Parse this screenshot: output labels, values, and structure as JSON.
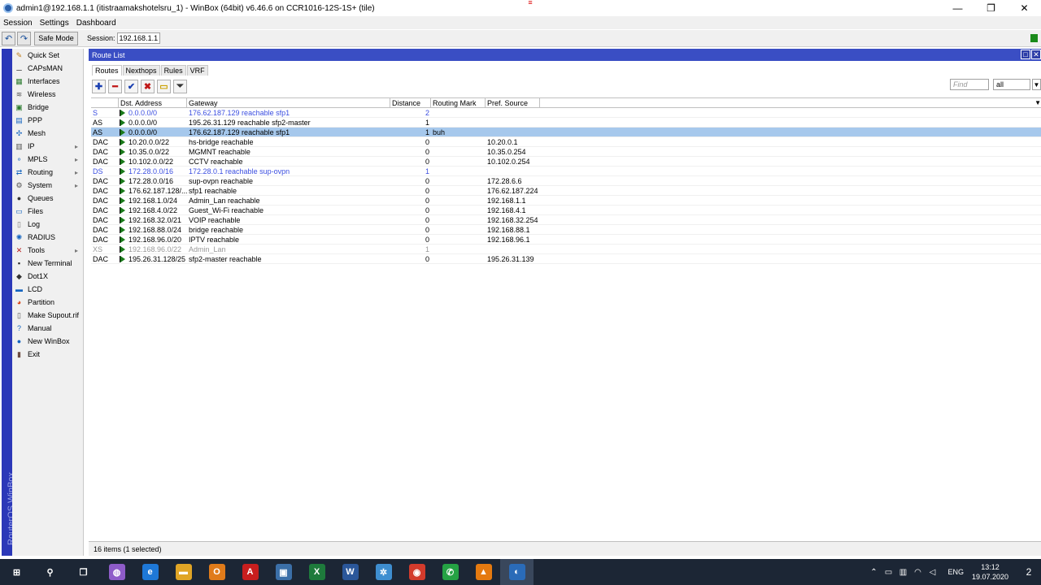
{
  "window": {
    "title": "admin1@192.168.1.1 (itistraamakshotelsru_1) - WinBox (64bit) v6.46.6 on CCR1016-12S-1S+ (tile)",
    "controls": [
      "—",
      "❐",
      "✕"
    ]
  },
  "menubar": [
    "Session",
    "Settings",
    "Dashboard"
  ],
  "toolbar": {
    "undo": "↶",
    "redo": "↷",
    "safe_mode": "Safe Mode",
    "session_label": "Session:",
    "session_value": "192.168.1.1"
  },
  "brand": "RouterOS WinBox",
  "sidebar": [
    {
      "label": "Quick Set",
      "icon": "quick-set-icon",
      "glyph": "✎",
      "color": "#c08020",
      "arrow": false
    },
    {
      "label": "CAPsMAN",
      "icon": "capsman-icon",
      "glyph": "⚊",
      "color": "#555555",
      "arrow": false
    },
    {
      "label": "Interfaces",
      "icon": "interfaces-icon",
      "glyph": "▦",
      "color": "#2e7d32",
      "arrow": false
    },
    {
      "label": "Wireless",
      "icon": "wireless-icon",
      "glyph": "≋",
      "color": "#555555",
      "arrow": false
    },
    {
      "label": "Bridge",
      "icon": "bridge-icon",
      "glyph": "▣",
      "color": "#2e7d32",
      "arrow": false
    },
    {
      "label": "PPP",
      "icon": "ppp-icon",
      "glyph": "▤",
      "color": "#1565c0",
      "arrow": false
    },
    {
      "label": "Mesh",
      "icon": "mesh-icon",
      "glyph": "✣",
      "color": "#1565c0",
      "arrow": false
    },
    {
      "label": "IP",
      "icon": "ip-icon",
      "glyph": "▥",
      "color": "#555555",
      "arrow": true
    },
    {
      "label": "MPLS",
      "icon": "mpls-icon",
      "glyph": "⚬",
      "color": "#1565c0",
      "arrow": true
    },
    {
      "label": "Routing",
      "icon": "routing-icon",
      "glyph": "⇄",
      "color": "#1565c0",
      "arrow": true
    },
    {
      "label": "System",
      "icon": "system-icon",
      "glyph": "⚙",
      "color": "#555555",
      "arrow": true
    },
    {
      "label": "Queues",
      "icon": "queues-icon",
      "glyph": "●",
      "color": "#333333",
      "arrow": false
    },
    {
      "label": "Files",
      "icon": "files-icon",
      "glyph": "▭",
      "color": "#1565c0",
      "arrow": false
    },
    {
      "label": "Log",
      "icon": "log-icon",
      "glyph": "▯",
      "color": "#777777",
      "arrow": false
    },
    {
      "label": "RADIUS",
      "icon": "radius-icon",
      "glyph": "✺",
      "color": "#1565c0",
      "arrow": false
    },
    {
      "label": "Tools",
      "icon": "tools-icon",
      "glyph": "✕",
      "color": "#b71c1c",
      "arrow": true
    },
    {
      "label": "New Terminal",
      "icon": "terminal-icon",
      "glyph": "▪",
      "color": "#222222",
      "arrow": false
    },
    {
      "label": "Dot1X",
      "icon": "dot1x-icon",
      "glyph": "◆",
      "color": "#333333",
      "arrow": false
    },
    {
      "label": "LCD",
      "icon": "lcd-icon",
      "glyph": "▬",
      "color": "#1565c0",
      "arrow": false
    },
    {
      "label": "Partition",
      "icon": "partition-icon",
      "glyph": "◕",
      "color": "#d84315",
      "arrow": false
    },
    {
      "label": "Make Supout.rif",
      "icon": "supout-icon",
      "glyph": "▯",
      "color": "#555555",
      "arrow": false
    },
    {
      "label": "Manual",
      "icon": "manual-icon",
      "glyph": "?",
      "color": "#1565c0",
      "arrow": false
    },
    {
      "label": "New WinBox",
      "icon": "winbox-icon",
      "glyph": "●",
      "color": "#1565c0",
      "arrow": false
    },
    {
      "label": "Exit",
      "icon": "exit-icon",
      "glyph": "▮",
      "color": "#6d4c41",
      "arrow": false
    }
  ],
  "route_list": {
    "title": "Route List",
    "tabs": [
      "Routes",
      "Nexthops",
      "Rules",
      "VRF"
    ],
    "active_tab": "Routes",
    "find_placeholder": "Find",
    "find_filter": "all",
    "columns": [
      "",
      "Dst. Address",
      "Gateway",
      "Distance",
      "Routing Mark",
      "Pref. Source"
    ],
    "rows": [
      {
        "flags": "S",
        "dst": "0.0.0.0/0",
        "gateway": "176.62.187.129 reachable sfp1",
        "distance": "2",
        "mark": "",
        "pref": "",
        "style": "blue"
      },
      {
        "flags": "AS",
        "dst": "0.0.0.0/0",
        "gateway": "195.26.31.129 reachable sfp2-master",
        "distance": "1",
        "mark": "",
        "pref": "",
        "style": ""
      },
      {
        "flags": "AS",
        "dst": "0.0.0.0/0",
        "gateway": "176.62.187.129 reachable sfp1",
        "distance": "1",
        "mark": "buh",
        "pref": "",
        "style": "selected"
      },
      {
        "flags": "DAC",
        "dst": "10.20.0.0/22",
        "gateway": "hs-bridge reachable",
        "distance": "0",
        "mark": "",
        "pref": "10.20.0.1",
        "style": ""
      },
      {
        "flags": "DAC",
        "dst": "10.35.0.0/22",
        "gateway": "MGMNT reachable",
        "distance": "0",
        "mark": "",
        "pref": "10.35.0.254",
        "style": ""
      },
      {
        "flags": "DAC",
        "dst": "10.102.0.0/22",
        "gateway": "CCTV reachable",
        "distance": "0",
        "mark": "",
        "pref": "10.102.0.254",
        "style": ""
      },
      {
        "flags": "DS",
        "dst": "172.28.0.0/16",
        "gateway": "172.28.0.1 reachable sup-ovpn",
        "distance": "1",
        "mark": "",
        "pref": "",
        "style": "blue"
      },
      {
        "flags": "DAC",
        "dst": "172.28.0.0/16",
        "gateway": "sup-ovpn reachable",
        "distance": "0",
        "mark": "",
        "pref": "172.28.6.6",
        "style": ""
      },
      {
        "flags": "DAC",
        "dst": "176.62.187.128/...",
        "gateway": "sfp1 reachable",
        "distance": "0",
        "mark": "",
        "pref": "176.62.187.224",
        "style": ""
      },
      {
        "flags": "DAC",
        "dst": "192.168.1.0/24",
        "gateway": "Admin_Lan reachable",
        "distance": "0",
        "mark": "",
        "pref": "192.168.1.1",
        "style": ""
      },
      {
        "flags": "DAC",
        "dst": "192.168.4.0/22",
        "gateway": "Guest_Wi-Fi reachable",
        "distance": "0",
        "mark": "",
        "pref": "192.168.4.1",
        "style": ""
      },
      {
        "flags": "DAC",
        "dst": "192.168.32.0/21",
        "gateway": "VOIP reachable",
        "distance": "0",
        "mark": "",
        "pref": "192.168.32.254",
        "style": ""
      },
      {
        "flags": "DAC",
        "dst": "192.168.88.0/24",
        "gateway": "bridge reachable",
        "distance": "0",
        "mark": "",
        "pref": "192.168.88.1",
        "style": ""
      },
      {
        "flags": "DAC",
        "dst": "192.168.96.0/20",
        "gateway": "IPTV reachable",
        "distance": "0",
        "mark": "",
        "pref": "192.168.96.1",
        "style": ""
      },
      {
        "flags": "XS",
        "dst": "192.168.96.0/22",
        "gateway": "Admin_Lan",
        "distance": "1",
        "mark": "",
        "pref": "",
        "style": "gray"
      },
      {
        "flags": "DAC",
        "dst": "195.26.31.128/25",
        "gateway": "sfp2-master reachable",
        "distance": "0",
        "mark": "",
        "pref": "195.26.31.139",
        "style": ""
      }
    ],
    "status": "16 items (1 selected)"
  },
  "taskbar": {
    "apps": [
      {
        "name": "start-button",
        "glyph": "⊞",
        "bg": "transparent"
      },
      {
        "name": "search-icon",
        "glyph": "⚲",
        "bg": "transparent"
      },
      {
        "name": "task-view-icon",
        "glyph": "❐",
        "bg": "transparent"
      },
      {
        "name": "viber-icon",
        "glyph": "◍",
        "bg": "#8e5cc9"
      },
      {
        "name": "edge-icon",
        "glyph": "e",
        "bg": "#1e78d7"
      },
      {
        "name": "explorer-icon",
        "glyph": "▬",
        "bg": "#e0a526"
      },
      {
        "name": "outlook-icon",
        "glyph": "O",
        "bg": "#e07b1a"
      },
      {
        "name": "acrobat-icon",
        "glyph": "A",
        "bg": "#c81e1e"
      },
      {
        "name": "network-icon",
        "glyph": "▣",
        "bg": "#3b6fa8"
      },
      {
        "name": "excel-icon",
        "glyph": "X",
        "bg": "#1e7a3c"
      },
      {
        "name": "word-icon",
        "glyph": "W",
        "bg": "#2b579a"
      },
      {
        "name": "settings-app-icon",
        "glyph": "✲",
        "bg": "#3e8ed0"
      },
      {
        "name": "chrome-icon",
        "glyph": "◉",
        "bg": "#d33b2c"
      },
      {
        "name": "whatsapp-icon",
        "glyph": "✆",
        "bg": "#25a244"
      },
      {
        "name": "vlc-icon",
        "glyph": "▲",
        "bg": "#e57a10"
      },
      {
        "name": "winbox-taskbar-icon",
        "glyph": "◐",
        "bg": "#2a6bb8"
      }
    ],
    "language": "ENG",
    "time": "13:12",
    "date": "19.07.2020",
    "notifications": "2"
  }
}
